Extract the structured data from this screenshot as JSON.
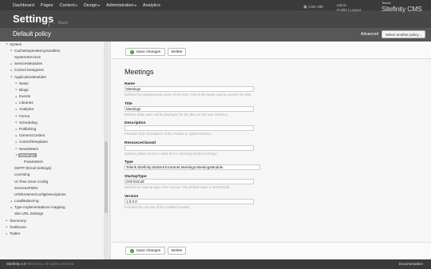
{
  "nav": {
    "items": [
      {
        "label": "Dashboard",
        "caret": false
      },
      {
        "label": "Pages",
        "caret": false
      },
      {
        "label": "Content",
        "caret": true
      },
      {
        "label": "Design",
        "caret": true
      },
      {
        "label": "Administration",
        "caret": true
      },
      {
        "label": "Analytics",
        "caret": false
      }
    ],
    "caret_symbol": "▾",
    "live_icon": "live-site-icon",
    "live_label": "Live site",
    "user_name": "admin",
    "user_links": "Profile | Logout",
    "brand_small": "Telerik",
    "brand_big": "Sitefinity CMS"
  },
  "header": {
    "title": "Settings",
    "back_label": "Basic",
    "back_icon": "arrow-left-icon"
  },
  "subheader": {
    "page_title": "Default policy",
    "advanced_label": "Advanced",
    "select_policy_label": "Select another policy..."
  },
  "tree": [
    {
      "label": "System",
      "indent": 2,
      "toggle": "▾",
      "selected": false
    },
    {
      "label": "CacheDependencyHandlers",
      "indent": 3,
      "toggle": "▸",
      "selected": false
    },
    {
      "label": "SystemServices",
      "indent": 3,
      "toggle": "",
      "selected": false
    },
    {
      "label": "ServicesModules",
      "indent": 3,
      "toggle": "▸",
      "selected": false
    },
    {
      "label": "Control Designers",
      "indent": 3,
      "toggle": "▸",
      "selected": false
    },
    {
      "label": "ApplicationModules",
      "indent": 3,
      "toggle": "▾",
      "selected": false
    },
    {
      "label": "News",
      "indent": 4,
      "toggle": "▸",
      "selected": false
    },
    {
      "label": "Blogs",
      "indent": 4,
      "toggle": "▸",
      "selected": false
    },
    {
      "label": "Events",
      "indent": 4,
      "toggle": "▸",
      "selected": false
    },
    {
      "label": "Libraries",
      "indent": 4,
      "toggle": "▸",
      "selected": false
    },
    {
      "label": "Analytics",
      "indent": 4,
      "toggle": "▸",
      "selected": false
    },
    {
      "label": "Forms",
      "indent": 4,
      "toggle": "▸",
      "selected": false
    },
    {
      "label": "Scheduling",
      "indent": 4,
      "toggle": "▸",
      "selected": false
    },
    {
      "label": "Publishing",
      "indent": 4,
      "toggle": "▸",
      "selected": false
    },
    {
      "label": "GenericContent",
      "indent": 4,
      "toggle": "▸",
      "selected": false
    },
    {
      "label": "ControlTemplates",
      "indent": 4,
      "toggle": "▸",
      "selected": false
    },
    {
      "label": "Newsletters",
      "indent": 4,
      "toggle": "▸",
      "selected": false
    },
    {
      "label": "Meetings",
      "indent": 4,
      "toggle": "▾",
      "selected": true
    },
    {
      "label": "Parameters",
      "indent": 5,
      "toggle": "",
      "selected": false
    },
    {
      "label": "SMTP (Email Settings)",
      "indent": 3,
      "toggle": "",
      "selected": false
    },
    {
      "label": "Licensing",
      "indent": 3,
      "toggle": "",
      "selected": false
    },
    {
      "label": "UI Time Zone Config",
      "indent": 3,
      "toggle": "",
      "selected": false
    },
    {
      "label": "ServicesPaths",
      "indent": 3,
      "toggle": "",
      "selected": false
    },
    {
      "label": "UrlShortenerConfigDescriptions",
      "indent": 3,
      "toggle": "",
      "selected": false
    },
    {
      "label": "LoadBalancing",
      "indent": 3,
      "toggle": "▸",
      "selected": false
    },
    {
      "label": "Type implementations mapping",
      "indent": 3,
      "toggle": "▸",
      "selected": false
    },
    {
      "label": "Site URL Settings",
      "indent": 3,
      "toggle": "",
      "selected": false
    },
    {
      "label": "Taxonomy",
      "indent": 2,
      "toggle": "▸",
      "selected": false
    },
    {
      "label": "Toolboxes",
      "indent": 2,
      "toggle": "▸",
      "selected": false
    },
    {
      "label": "Twitter",
      "indent": 2,
      "toggle": "▸",
      "selected": false
    }
  ],
  "toolbar": {
    "save_label": "Save changes",
    "save_icon": "check-icon",
    "delete_label": "Delete"
  },
  "form": {
    "heading": "Meetings",
    "fields": [
      {
        "label": "Name",
        "value": "Meetings",
        "hint": "Defines the programmatic name of the item. This is the name used to access the item."
      },
      {
        "label": "Title",
        "value": "Meetings",
        "hint": "Defines what name will be displayed for the item on the user interface."
      },
      {
        "label": "Description",
        "value": "",
        "hint": "Provides short description of the module or system service."
      },
      {
        "label": "ResourceClassId",
        "value": "",
        "hint": "Defines global resource class ID for retrieving localized strings."
      },
      {
        "label": "Type",
        "value": "Telerik.Sitefinity.StarterKit.Intranet.Meetings.MeetingsModule",
        "hint": ""
      },
      {
        "label": "StartupType",
        "value": "OnFirstCall",
        "hint": "Defines the startup type of the service. The default value is OnFirstCall."
      },
      {
        "label": "Version",
        "value": "1.0.0.0",
        "hint": "Indicates the version of the installed module."
      }
    ]
  },
  "footer": {
    "product": "Sitefinity 4.0",
    "copyright": "Telerik Inc. All rights reserved",
    "documentation": "Documentation"
  }
}
